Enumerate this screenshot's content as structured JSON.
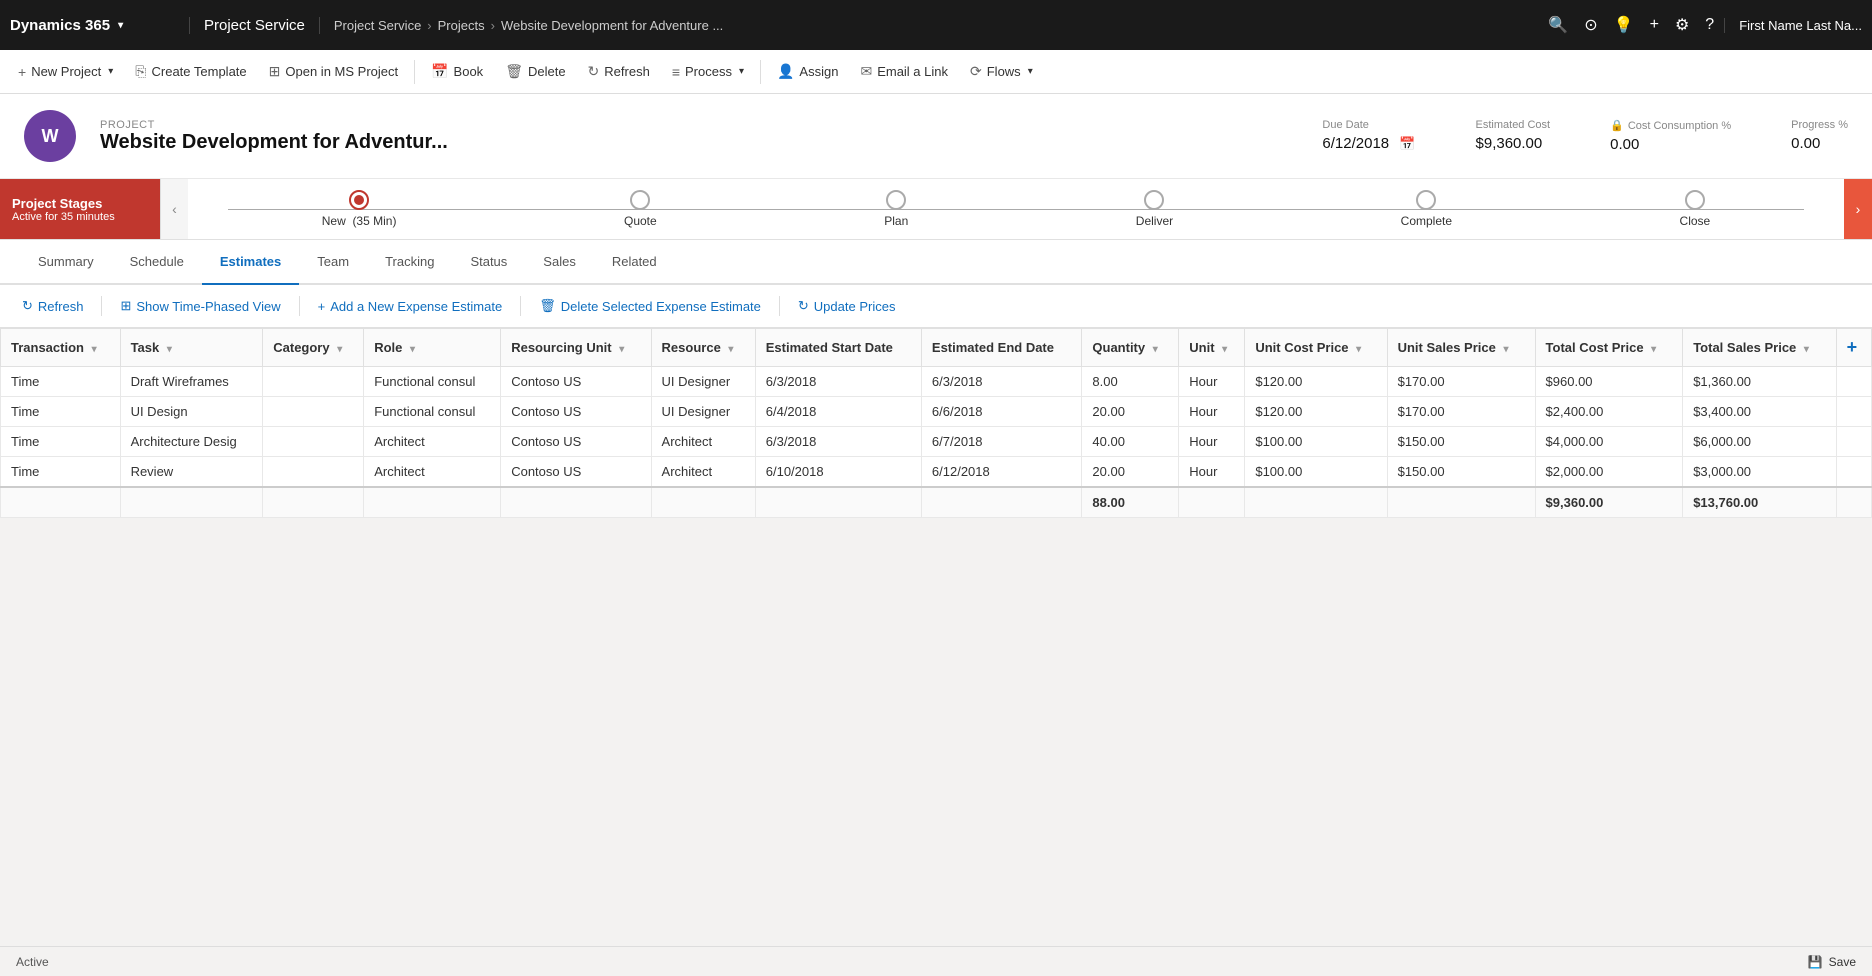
{
  "topNav": {
    "appTitle": "Dynamics 365",
    "moduleTitle": "Project Service",
    "breadcrumb": [
      "Project Service",
      "Projects",
      "Website Development for Adventure ..."
    ],
    "icons": [
      "🔍",
      "⊙",
      "💡",
      "+"
    ],
    "settingsIcon": "⚙",
    "helpIcon": "?",
    "userName": "First Name Last Na..."
  },
  "commandBar": {
    "buttons": [
      {
        "id": "new-project",
        "label": "New Project",
        "icon": "+"
      },
      {
        "id": "create-template",
        "label": "Create Template",
        "icon": "⎘"
      },
      {
        "id": "open-ms-project",
        "label": "Open in MS Project",
        "icon": "⊞"
      },
      {
        "id": "book",
        "label": "Book",
        "icon": "📅"
      },
      {
        "id": "delete",
        "label": "Delete",
        "icon": "🗑"
      },
      {
        "id": "refresh",
        "label": "Refresh",
        "icon": "↻"
      },
      {
        "id": "process",
        "label": "Process",
        "icon": "≡",
        "hasDropdown": true
      },
      {
        "id": "assign",
        "label": "Assign",
        "icon": "👤"
      },
      {
        "id": "email-link",
        "label": "Email a Link",
        "icon": "✉"
      },
      {
        "id": "flows",
        "label": "Flows",
        "icon": "⟳",
        "hasDropdown": true
      }
    ]
  },
  "project": {
    "label": "PROJECT",
    "name": "Website Development for Adventur...",
    "avatar": "W",
    "dueDate": "6/12/2018",
    "estimatedCost": "$9,360.00",
    "costConsumptionPercent": "0.00",
    "progressPercent": "0.00",
    "dueDateLabel": "Due Date",
    "estimatedCostLabel": "Estimated Cost",
    "costConsumptionLabel": "Cost Consumption %",
    "progressLabel": "Progress %"
  },
  "stages": {
    "panelTitle": "Project Stages",
    "panelStatus": "Active for 35 minutes",
    "items": [
      {
        "id": "new",
        "label": "New",
        "sublabel": "(35 Min)",
        "active": true
      },
      {
        "id": "quote",
        "label": "Quote",
        "active": false
      },
      {
        "id": "plan",
        "label": "Plan",
        "active": false
      },
      {
        "id": "deliver",
        "label": "Deliver",
        "active": false
      },
      {
        "id": "complete",
        "label": "Complete",
        "active": false
      },
      {
        "id": "close",
        "label": "Close",
        "active": false
      }
    ]
  },
  "tabs": {
    "items": [
      {
        "id": "summary",
        "label": "Summary",
        "active": false
      },
      {
        "id": "schedule",
        "label": "Schedule",
        "active": false
      },
      {
        "id": "estimates",
        "label": "Estimates",
        "active": true
      },
      {
        "id": "team",
        "label": "Team",
        "active": false
      },
      {
        "id": "tracking",
        "label": "Tracking",
        "active": false
      },
      {
        "id": "status",
        "label": "Status",
        "active": false
      },
      {
        "id": "sales",
        "label": "Sales",
        "active": false
      },
      {
        "id": "related",
        "label": "Related",
        "active": false
      }
    ]
  },
  "estimatesToolbar": {
    "buttons": [
      {
        "id": "refresh",
        "label": "Refresh",
        "icon": "↻"
      },
      {
        "id": "show-time-phased",
        "label": "Show Time-Phased View",
        "icon": "⊞"
      },
      {
        "id": "add-expense",
        "label": "Add a New Expense Estimate",
        "icon": "+"
      },
      {
        "id": "delete-expense",
        "label": "Delete Selected Expense Estimate",
        "icon": "🗑"
      },
      {
        "id": "update-prices",
        "label": "Update Prices",
        "icon": "↻"
      }
    ]
  },
  "table": {
    "columns": [
      {
        "id": "transaction",
        "label": "Transaction"
      },
      {
        "id": "task",
        "label": "Task"
      },
      {
        "id": "category",
        "label": "Category"
      },
      {
        "id": "role",
        "label": "Role"
      },
      {
        "id": "resourcing-unit",
        "label": "Resourcing Unit"
      },
      {
        "id": "resource",
        "label": "Resource"
      },
      {
        "id": "est-start-date",
        "label": "Estimated Start Date"
      },
      {
        "id": "est-end-date",
        "label": "Estimated End Date"
      },
      {
        "id": "quantity",
        "label": "Quantity"
      },
      {
        "id": "unit",
        "label": "Unit"
      },
      {
        "id": "unit-cost-price",
        "label": "Unit Cost Price"
      },
      {
        "id": "unit-sales-price",
        "label": "Unit Sales Price"
      },
      {
        "id": "total-cost-price",
        "label": "Total Cost Price"
      },
      {
        "id": "total-sales-price",
        "label": "Total Sales Price"
      },
      {
        "id": "add-column",
        "label": "Add Column"
      }
    ],
    "rows": [
      {
        "transaction": "Time",
        "task": "Draft Wireframes",
        "category": "",
        "role": "Functional consul",
        "resourcingUnit": "Contoso US",
        "resource": "UI Designer",
        "estStartDate": "6/3/2018",
        "estEndDate": "6/3/2018",
        "quantity": "8.00",
        "unit": "Hour",
        "unitCostPrice": "$120.00",
        "unitSalesPrice": "$170.00",
        "totalCostPrice": "$960.00",
        "totalSalesPrice": "$1,360.00"
      },
      {
        "transaction": "Time",
        "task": "UI Design",
        "category": "",
        "role": "Functional consul",
        "resourcingUnit": "Contoso US",
        "resource": "UI Designer",
        "estStartDate": "6/4/2018",
        "estEndDate": "6/6/2018",
        "quantity": "20.00",
        "unit": "Hour",
        "unitCostPrice": "$120.00",
        "unitSalesPrice": "$170.00",
        "totalCostPrice": "$2,400.00",
        "totalSalesPrice": "$3,400.00"
      },
      {
        "transaction": "Time",
        "task": "Architecture Desig",
        "category": "",
        "role": "Architect",
        "resourcingUnit": "Contoso US",
        "resource": "Architect",
        "estStartDate": "6/3/2018",
        "estEndDate": "6/7/2018",
        "quantity": "40.00",
        "unit": "Hour",
        "unitCostPrice": "$100.00",
        "unitSalesPrice": "$150.00",
        "totalCostPrice": "$4,000.00",
        "totalSalesPrice": "$6,000.00"
      },
      {
        "transaction": "Time",
        "task": "Review",
        "category": "",
        "role": "Architect",
        "resourcingUnit": "Contoso US",
        "resource": "Architect",
        "estStartDate": "6/10/2018",
        "estEndDate": "6/12/2018",
        "quantity": "20.00",
        "unit": "Hour",
        "unitCostPrice": "$100.00",
        "unitSalesPrice": "$150.00",
        "totalCostPrice": "$2,000.00",
        "totalSalesPrice": "$3,000.00"
      }
    ],
    "totals": {
      "quantity": "88.00",
      "totalCostPrice": "$9,360.00",
      "totalSalesPrice": "$13,760.00"
    }
  },
  "statusBar": {
    "status": "Active",
    "saveLabel": "Save",
    "saveIcon": "💾"
  }
}
